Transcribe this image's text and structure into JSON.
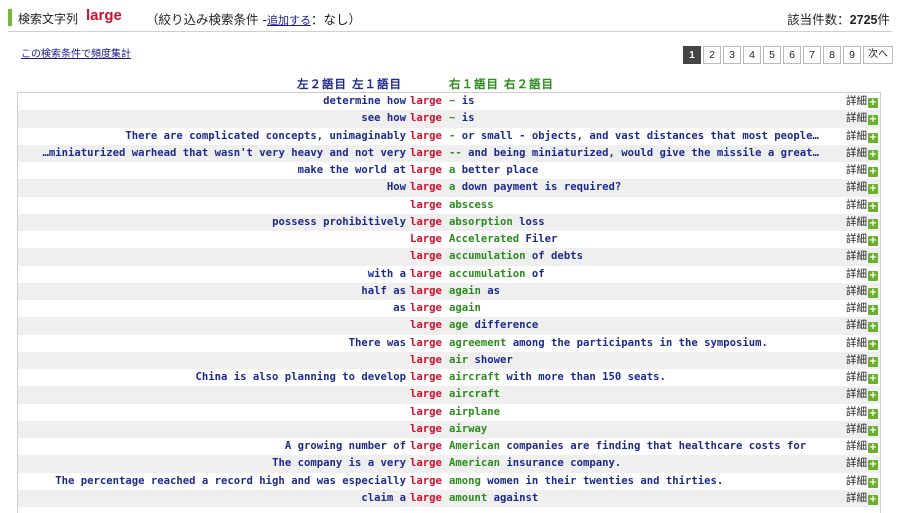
{
  "header": {
    "label": "検索文字列",
    "term": "large",
    "cond_prefix": "（絞り込み検索条件 -",
    "cond_add": "追加する",
    "cond_suffix": "：なし）",
    "count_label": "該当件数：",
    "count_value": "2725",
    "count_unit": "件"
  },
  "freq_link": "この検索条件で頻度集計",
  "pager": {
    "pages": [
      "1",
      "2",
      "3",
      "4",
      "5",
      "6",
      "7",
      "8",
      "9"
    ],
    "current": "1",
    "next": "次へ"
  },
  "columns": {
    "left": "左２語目 左１語目",
    "right": "右１語目 右２語目"
  },
  "detail_label": "詳細",
  "rows": [
    {
      "left": "determine how",
      "kw": "large",
      "r1": "~",
      "rest": " is"
    },
    {
      "left": "see how",
      "kw": "large",
      "r1": "~",
      "rest": " is"
    },
    {
      "left": "There are complicated concepts, unimaginably",
      "kw": "large",
      "r1": "-",
      "rest": " or small - objects, and vast distances that most people…"
    },
    {
      "left": "…miniaturized warhead that wasn't very heavy and not very",
      "kw": "large",
      "r1": "--",
      "rest": " and being miniaturized, would give the missile a great…"
    },
    {
      "left": "make the world at",
      "kw": "large",
      "r1": "a",
      "rest": " better place"
    },
    {
      "left": "How",
      "kw": "large",
      "r1": "a",
      "rest": " down payment is required?"
    },
    {
      "left": "",
      "kw": "large",
      "r1": "abscess",
      "rest": ""
    },
    {
      "left": "possess prohibitively",
      "kw": "large",
      "r1": "absorption",
      "rest": " loss"
    },
    {
      "left": "",
      "kw": "Large",
      "r1": "Accelerated",
      "rest": " Filer"
    },
    {
      "left": "",
      "kw": "large",
      "r1": "accumulation",
      "rest": " of debts"
    },
    {
      "left": "with a",
      "kw": "large",
      "r1": "accumulation",
      "rest": " of"
    },
    {
      "left": "half as",
      "kw": "large",
      "r1": "again",
      "rest": " as"
    },
    {
      "left": "as",
      "kw": "large",
      "r1": "again",
      "rest": ""
    },
    {
      "left": "",
      "kw": "large",
      "r1": "age",
      "rest": " difference"
    },
    {
      "left": "There was",
      "kw": "large",
      "r1": "agreement",
      "rest": " among the participants in the symposium."
    },
    {
      "left": "",
      "kw": "large",
      "r1": "air",
      "rest": " shower"
    },
    {
      "left": "China is also planning to develop",
      "kw": "large",
      "r1": "aircraft",
      "rest": " with more than 150 seats."
    },
    {
      "left": "",
      "kw": "large",
      "r1": "aircraft",
      "rest": ""
    },
    {
      "left": "",
      "kw": "large",
      "r1": "airplane",
      "rest": ""
    },
    {
      "left": "",
      "kw": "large",
      "r1": "airway",
      "rest": ""
    },
    {
      "left": "A growing number of",
      "kw": "large",
      "r1": "American",
      "rest": " companies are finding that healthcare costs for"
    },
    {
      "left": "The company is a very",
      "kw": "large",
      "r1": "American",
      "rest": " insurance company."
    },
    {
      "left": "The percentage reached a record high and was especially",
      "kw": "large",
      "r1": "among",
      "rest": " women in their twenties and thirties."
    },
    {
      "left": "claim a",
      "kw": "large",
      "r1": "amount",
      "rest": " against"
    }
  ]
}
